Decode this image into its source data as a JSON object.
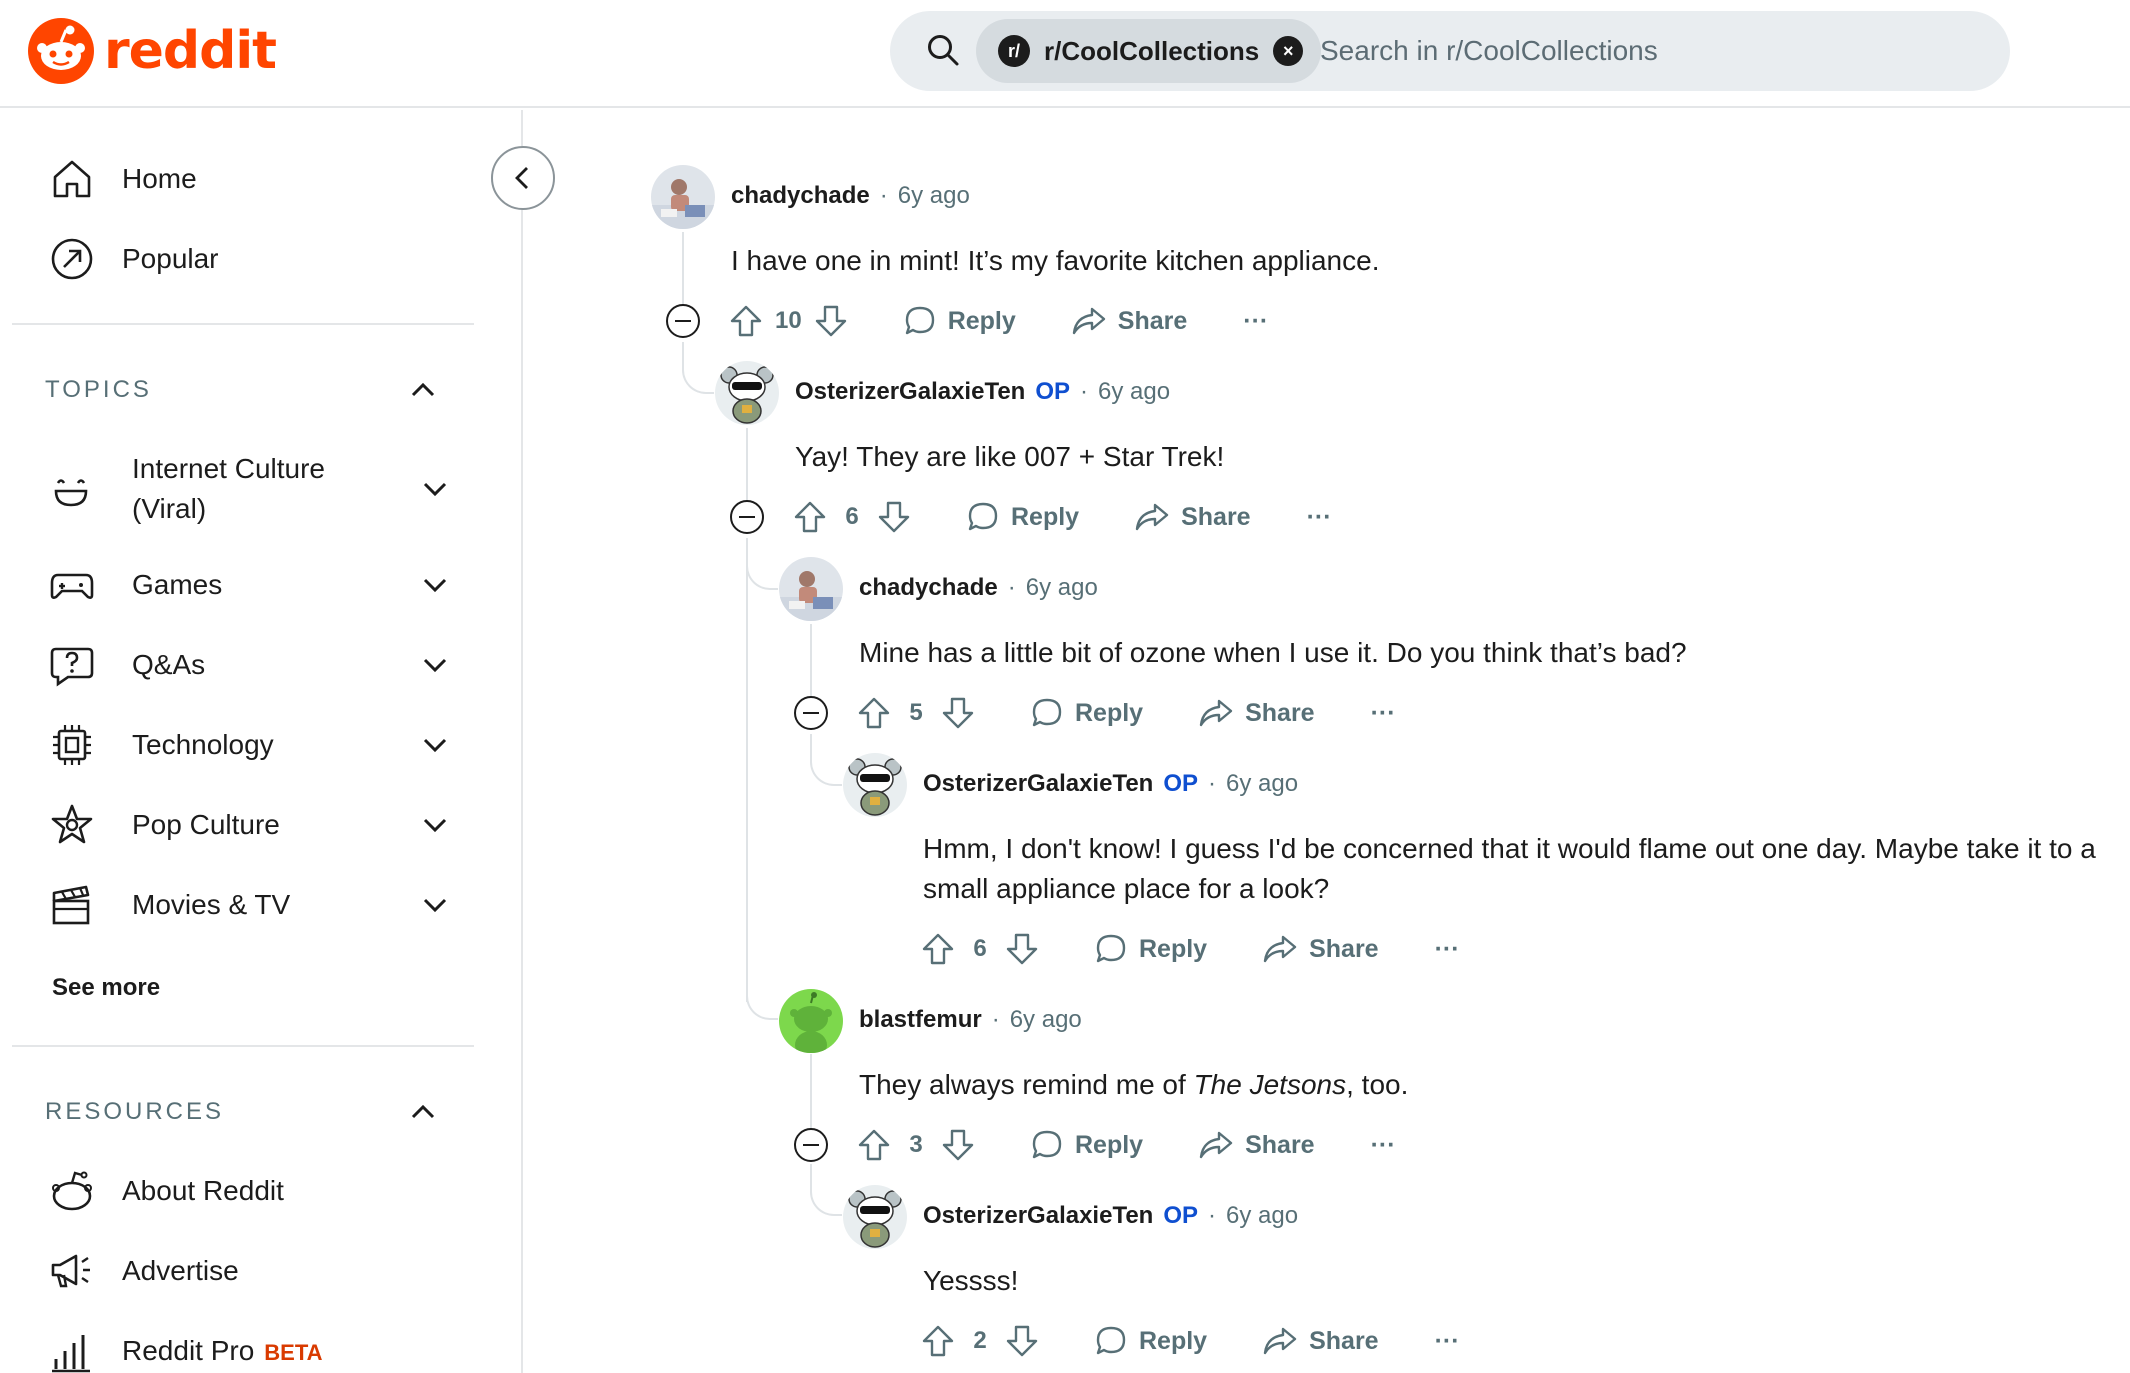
{
  "header": {
    "logo_text": "reddit",
    "search": {
      "subreddit_badge": "r/",
      "subreddit": "r/CoolCollections",
      "clear_symbol": "×",
      "placeholder": "Search in r/CoolCollections"
    }
  },
  "sidebar": {
    "nav": [
      {
        "label": "Home",
        "icon": "home-icon"
      },
      {
        "label": "Popular",
        "icon": "popular-icon"
      }
    ],
    "topics_header": "TOPICS",
    "topics": [
      {
        "label": "Internet Culture (Viral)",
        "icon": "smile-icon"
      },
      {
        "label": "Games",
        "icon": "gamepad-icon"
      },
      {
        "label": "Q&As",
        "icon": "question-bubble-icon"
      },
      {
        "label": "Technology",
        "icon": "chip-icon"
      },
      {
        "label": "Pop Culture",
        "icon": "star-icon"
      },
      {
        "label": "Movies & TV",
        "icon": "clapperboard-icon"
      }
    ],
    "see_more": "See more",
    "resources_header": "RESOURCES",
    "resources": [
      {
        "label": "About Reddit",
        "icon": "reddit-alien-icon"
      },
      {
        "label": "Advertise",
        "icon": "megaphone-icon"
      },
      {
        "label": "Reddit Pro",
        "badge": "BETA",
        "icon": "bar-chart-icon"
      }
    ]
  },
  "comments": [
    {
      "author": "chadychade",
      "op": "",
      "dot": "·",
      "time": "6y ago",
      "body": "I have one in mint! It’s my favorite kitchen appliance.",
      "votes": "10",
      "reply": "Reply",
      "share": "Share",
      "more": "···"
    },
    {
      "author": "OsterizerGalaxieTen",
      "op": "OP",
      "dot": "·",
      "time": "6y ago",
      "body": "Yay! They are like 007 + Star Trek!",
      "votes": "6",
      "reply": "Reply",
      "share": "Share",
      "more": "···"
    },
    {
      "author": "chadychade",
      "op": "",
      "dot": "·",
      "time": "6y ago",
      "body": "Mine has a little bit of ozone when I use it. Do you think that’s bad?",
      "votes": "5",
      "reply": "Reply",
      "share": "Share",
      "more": "···"
    },
    {
      "author": "OsterizerGalaxieTen",
      "op": "OP",
      "dot": "·",
      "time": "6y ago",
      "body": "Hmm, I don't know! I guess I'd be concerned that it would flame out one day. Maybe take it to a small appliance place for a look?",
      "votes": "6",
      "reply": "Reply",
      "share": "Share",
      "more": "···"
    },
    {
      "author": "blastfemur",
      "op": "",
      "dot": "·",
      "time": "6y ago",
      "body_pre": "They always remind me of ",
      "body_italic": "The Jetsons",
      "body_post": ", too.",
      "votes": "3",
      "reply": "Reply",
      "share": "Share",
      "more": "···"
    },
    {
      "author": "OsterizerGalaxieTen",
      "op": "OP",
      "dot": "·",
      "time": "6y ago",
      "body": "Yessss!",
      "votes": "2",
      "reply": "Reply",
      "share": "Share",
      "more": "···"
    }
  ],
  "colors": {
    "brand": "#ff4500",
    "op": "#0f4fd0",
    "meta": "#576f76"
  }
}
